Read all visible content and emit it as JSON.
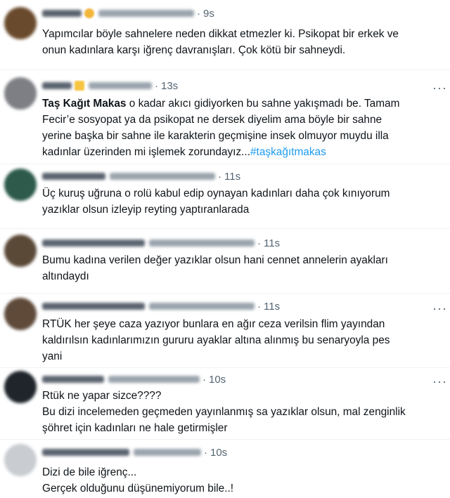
{
  "tweets": [
    {
      "time": "9s",
      "lines": [
        "Yapımcılar böyle sahnelere neden dikkat etmezler ki. Psikopat bir erkek ve",
        "onun kadınlara karşı iğrenç davranışları. Çok kötü bir sahneydi."
      ],
      "avatar_color": "#6a4a2c"
    },
    {
      "time": "13s",
      "bold_lead": "Taş Kağıt Makas",
      "lines": [
        " o kadar akıcı gidiyorken bu sahne yakışmadı be. Tamam",
        "Fecir’e sosyopat ya da psikopat ne dersek diyelim ama böyle bir sahne",
        "yerine başka bir sahne ile karakterin geçmişine insek olmuyor muydu illa",
        "kadınlar üzerinden mi işlemek zorundayız..."
      ],
      "hashtag": "#taşkağıtmakas",
      "avatar_color": "#7d7f84"
    },
    {
      "time": "11s",
      "lines": [
        "Üç kuruş uğruna o rolü kabul edip oynayan kadınları daha çok kınıyorum",
        "yazıklar olsun izleyip reyting yaptıranlarada"
      ],
      "avatar_color": "#2d5a4a"
    },
    {
      "time": "11s",
      "lines": [
        "Bumu kadına verilen değer yazıklar olsun hani cennet annelerin ayakları",
        "altındaydı"
      ],
      "avatar_color": "#5b4938"
    },
    {
      "time": "11s",
      "lines": [
        "RTÜK her şeye caza yazıyor bunlara en ağır ceza verilsin flim yayından",
        "kaldırılsın kadınlarımızın gururu ayaklar altına alınmış bu senaryoyla pes",
        "yani"
      ],
      "avatar_color": "#5f4a3a"
    },
    {
      "time": "10s",
      "lines": [
        "Rtük ne yapar sizce????",
        "Bu dizi incelemeden geçmeden yayınlanmış sa yazıklar olsun, mal zenginlik",
        "şöhret için kadınları ne hale getirmişler"
      ],
      "avatar_color": "#1f252b"
    },
    {
      "time": "10s",
      "lines": [
        "Dizi de bile iğrenç...",
        "Gerçek olduğunu düşünemiyorum bile..!"
      ],
      "avatar_color": "#c9ccd0"
    }
  ],
  "icons": {
    "more": "more-horizontal-icon"
  },
  "more_glyph": "···"
}
